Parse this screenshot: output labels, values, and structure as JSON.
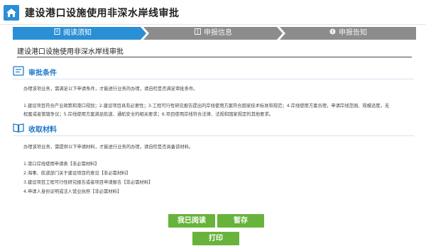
{
  "header": {
    "title": "建设港口设施使用非深水岸线审批"
  },
  "steps": [
    {
      "label": "阅读须知",
      "state": "active",
      "icon": "notebook-icon"
    },
    {
      "label": "申报信息",
      "state": "inactive",
      "icon": "form-icon"
    },
    {
      "label": "申报告知",
      "state": "inactive",
      "icon": "alert-icon"
    }
  ],
  "subtitle": "建设港口设施使用非深水岸线审批",
  "conditions": {
    "title": "审批条件",
    "intro": "办理该项业务，需满足以下申请条件，才能进行业务的办理，请自检是否满足审批条件。",
    "line1": "1.建设项目符合产业政策和港口规划；2.建设项目具有必要性；3.工程可行性研究报告提出的岸线使用方案符合国家技术标准和规范；4.岸线使用方案合理，申请岸线范围、规模适度，无",
    "line2": "权属或者管辖争议；5.岸线使用方案满足航道、通航安全的相关要求；6.项目使用岸线符合法律、法规和国家规定的其他要求。"
  },
  "materials": {
    "title": "收取材料",
    "intro": "办理该项业务，需提供以下申请材料，才能进行业务的办理，请自检是否具备该材料。",
    "items": [
      "1.港口岸线使用申请表【非必需材料】",
      "2.海事、航道部门关于建设项目的意见【非必需材料】",
      "3.建设项目工程可行性研究报告或者项目申请报告【非必需材料】",
      "4.申请人身份证明或法人营业执照【非必需材料】"
    ]
  },
  "buttons": {
    "read": "我已阅读",
    "save": "暂存",
    "print": "打印"
  },
  "colors": {
    "active_step": "#2b8fd6",
    "inactive_step": "#8c8c8c",
    "button": "#67b33b",
    "section_title": "#1f78c8"
  }
}
